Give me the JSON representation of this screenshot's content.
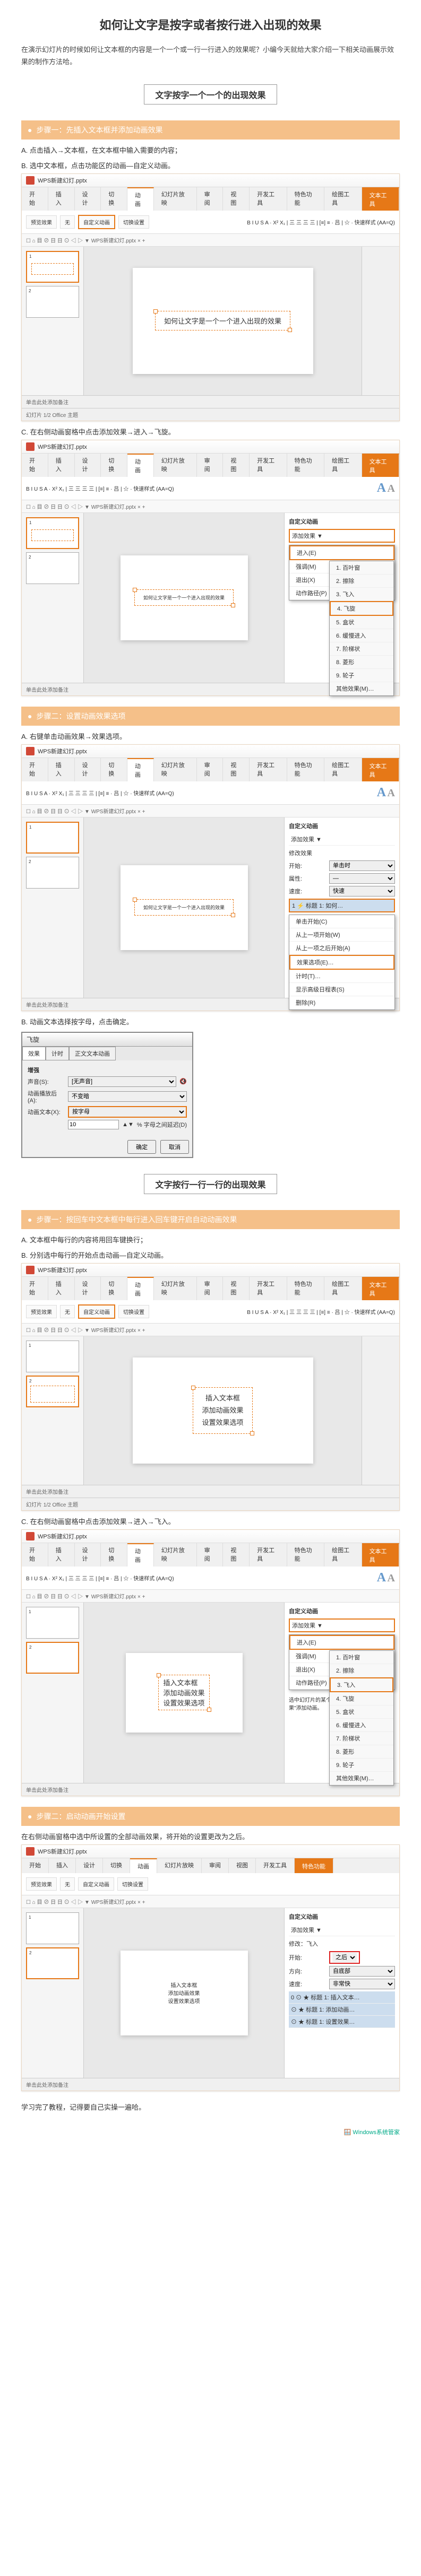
{
  "page_title": "如何让文字是按字或者按行进入出现的效果",
  "intro": "在演示幻灯片的时候如何让文本框的内容是一个一个或一行一行进入的效果呢？小编今天就给大家介绍一下相关动画展示效果的制作方法哈。",
  "divider1": "文字按字一个一个的出现效果",
  "divider2": "文字按行一行一行的出现效果",
  "step1": {
    "title": "步骤一：先插入文本框并添加动画效果",
    "a": "A. 点击插入→文本框，在文本框中输入需要的内容；",
    "b": "B. 选中文本框，点击功能区的动画—自定义动画。",
    "c": "C. 在右侧动画窗格中点击添加效果→进入→飞旋。"
  },
  "step2": {
    "title": "步骤二：设置动画效果选项",
    "a": "A. 右键单击动画效果→效果选项。",
    "b": "B. 动画文本选择按字母，点击确定。"
  },
  "step3": {
    "title": "步骤一：按回车中文本框中每行进入回车键开启自动动画效果",
    "a": "A. 文本框中每行的内容将用回车键换行；",
    "b": "B. 分别选中每行的开始点击动画—自定义动画。",
    "c": "C. 在右侧动画窗格中点击添加效果→进入→飞入。"
  },
  "step4": {
    "title": "步骤二：启动动画开始设置",
    "text": "在右侧动画窗格中选中所设置的全部动画效果，将开始的设置更改为之后。"
  },
  "closing": "学习完了教程，记得要自己实操一遍哈。",
  "footer": "Windows系统管家",
  "wps": {
    "filename": "WPS新建幻灯.pptx",
    "tab_file": "开始",
    "tab_insert": "插入",
    "tab_design": "设计",
    "tab_trans": "切换",
    "tab_anim": "动画",
    "tab_show": "幻灯片放映",
    "tab_review": "审阅",
    "tab_view": "视图",
    "tab_dev": "开发工具",
    "tab_special": "特色功能",
    "tab_draw": "绘图工具",
    "tab_text": "文本工具",
    "rib_preview": "预览效果",
    "rib_none": "无",
    "rib_custom": "自定义动画",
    "rib_trans": "切换设置",
    "toolbar_font": "B I U S A · X² X₁ | 三 三 三 三 | [≡] ≡ · 吕 | ☆ · 快速样式 (AA=Q)",
    "toolbar_file": "☐ ⌂ 目 ⊘ 日 日 ⊙ ◁ ▷ ▼",
    "slide_text1": "如何让文字是一个一个进入出现的效果",
    "slide_text2_1": "插入文本框",
    "slide_text2_2": "添加动画效果",
    "slide_text2_3": "设置效果选项",
    "notes": "单击此处添加备注",
    "anim_pane_title": "自定义动画",
    "anim_add": "添加效果 ▼",
    "anim_del": "删除",
    "anim_modify": "修改效果",
    "anim_start": "开始:",
    "anim_prop": "属性:",
    "anim_speed": "速度:",
    "anim_start_click": "单击时",
    "anim_start_after": "之后",
    "anim_speed_fast": "快速",
    "anim_list_item": "标题 1: 如何…",
    "anim_list_item2": "标题 1: 插入…",
    "menu_enter": "进入(E)",
    "menu_emphasis": "强调(M)",
    "menu_exit": "退出(X)",
    "menu_path": "动作路径(P)",
    "sub_blinds": "1. 百叶窗",
    "sub_wipe": "2. 擦除",
    "sub_fly": "3. 飞入",
    "sub_spin": "4. 飞旋",
    "sub_box": "5. 盒状",
    "sub_slow": "6. 缓慢进入",
    "sub_step": "7. 阶梯状",
    "sub_diamond": "8. 菱形",
    "sub_wheel": "9. 轮子",
    "sub_more": "其他效果(M)…",
    "ctx_start_click": "单击开始(C)",
    "ctx_start_prev": "从上一项开始(W)",
    "ctx_start_after": "从上一项之后开始(A)",
    "ctx_effect": "效果选项(E)…",
    "ctx_timing": "计时(T)…",
    "ctx_text": "显示高级日程表(S)",
    "ctx_remove": "删除(R)",
    "status": "幻灯片 1/2  Office 主题"
  },
  "dialog": {
    "title": "飞旋",
    "tab_effect": "效果",
    "tab_timing": "计时",
    "tab_text": "正文文本动画",
    "label_enhance": "增强",
    "label_sound": "声音(S):",
    "label_after": "动画播放后(A):",
    "label_text": "动画文本(X):",
    "val_none": "[无声音]",
    "val_dim": "不变暗",
    "val_letter": "按字母",
    "delay_label": "% 字母之间延迟(D)",
    "delay_val": "10",
    "ok": "确定",
    "cancel": "取消"
  }
}
